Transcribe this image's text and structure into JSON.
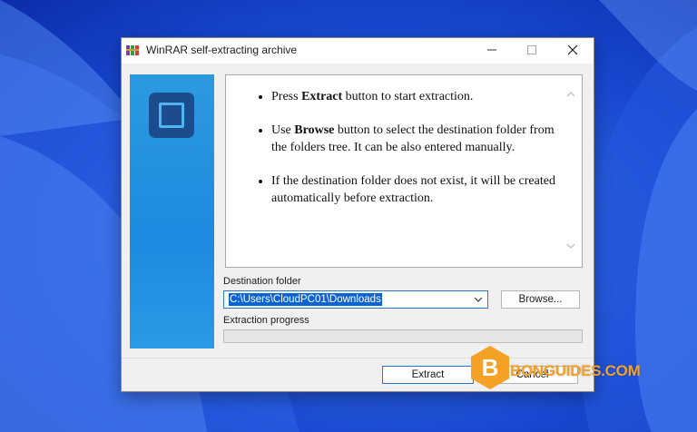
{
  "window": {
    "title": "WinRAR self-extracting archive",
    "icons": {
      "app": "winrar-books-icon",
      "minimize": "minimize-icon",
      "maximize": "maximize-icon",
      "close": "close-icon"
    }
  },
  "info": {
    "items": [
      {
        "before": "Press ",
        "bold": "Extract",
        "after": " button to start extraction."
      },
      {
        "before": "Use ",
        "bold": "Browse",
        "after": " button to select the destination folder from the folders tree. It can be also entered manually."
      },
      {
        "before": "",
        "bold": "",
        "after": "If the destination folder does not exist, it will be created automatically before extraction."
      }
    ]
  },
  "destination": {
    "label": "Destination folder",
    "path": "C:\\Users\\CloudPC01\\Downloads",
    "browse_label": "Browse..."
  },
  "progress": {
    "label": "Extraction progress",
    "value": 0
  },
  "buttons": {
    "extract_label": "Extract",
    "cancel_label": "Cancel"
  },
  "watermark": {
    "letter": "B",
    "text": "BONGUIDES.COM"
  },
  "colors": {
    "accent": "#2e76c8",
    "selection": "#0b63d6",
    "side_panel": "#1e8ae0",
    "watermark": "#f4a125"
  }
}
